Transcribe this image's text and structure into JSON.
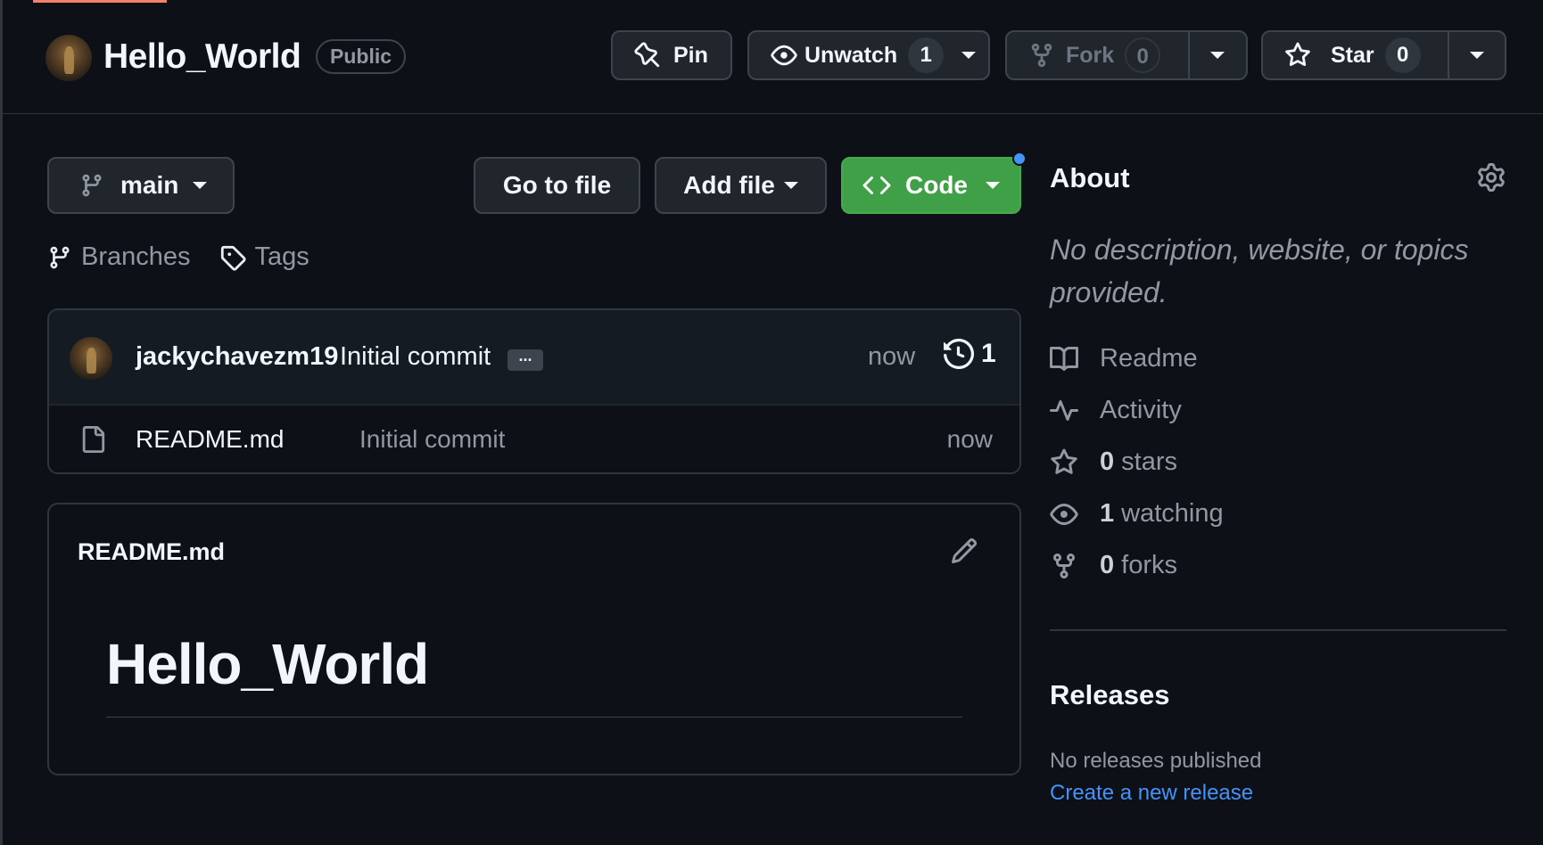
{
  "repo": {
    "name": "Hello_World",
    "visibility": "Public"
  },
  "header_actions": {
    "pin_label": "Pin",
    "unwatch_label": "Unwatch",
    "watch_count": "1",
    "fork_label": "Fork",
    "fork_count": "0",
    "star_label": "Star",
    "star_count": "0"
  },
  "toolbar": {
    "branch": "main",
    "go_to_file": "Go to file",
    "add_file": "Add file",
    "code": "Code"
  },
  "branch_links": {
    "branches": "Branches",
    "tags": "Tags"
  },
  "latest_commit": {
    "author": "jackychavezm19",
    "message": "Initial commit",
    "ellipsis": "...",
    "time": "now",
    "commit_count": "1"
  },
  "files": [
    {
      "name": "README.md",
      "commit_message": "Initial commit",
      "time": "now"
    }
  ],
  "readme": {
    "filename": "README.md",
    "heading": "Hello_World"
  },
  "about": {
    "title": "About",
    "description": "No description, website, or topics provided.",
    "readme_label": "Readme",
    "activity_label": "Activity",
    "stars_count": "0",
    "stars_label": "stars",
    "watching_count": "1",
    "watching_label": "watching",
    "forks_count": "0",
    "forks_label": "forks"
  },
  "releases": {
    "title": "Releases",
    "none_text": "No releases published",
    "create_link": "Create a new release"
  },
  "colors": {
    "background": "#0d1117",
    "code_button": "#3fa048",
    "link": "#4493f8",
    "muted_text": "#9198a1"
  }
}
